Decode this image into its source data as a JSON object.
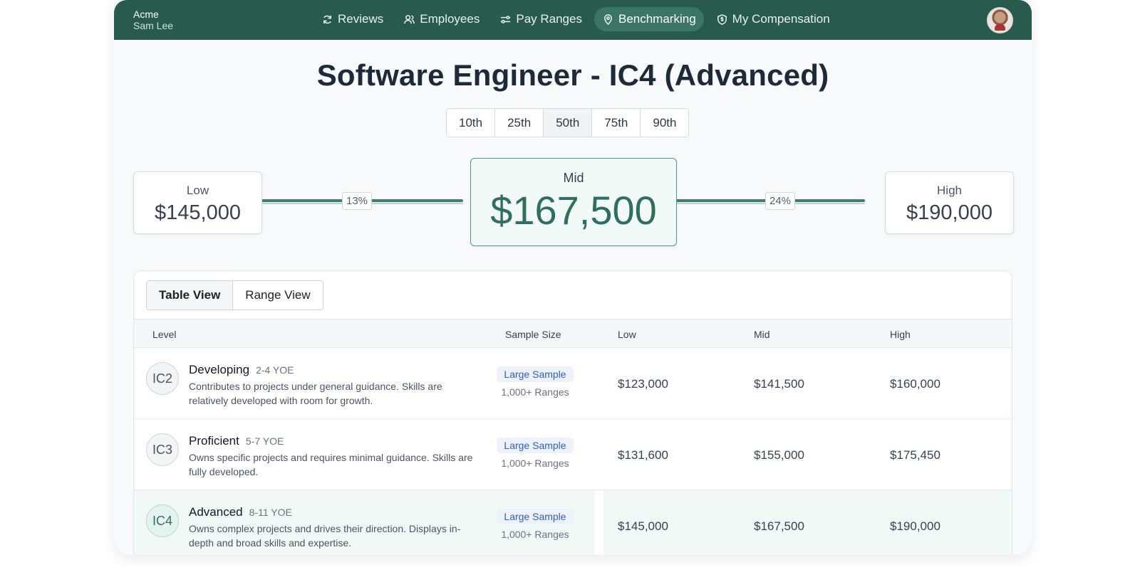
{
  "header": {
    "org": "Acme",
    "user": "Sam Lee",
    "nav": [
      {
        "label": "Reviews",
        "icon": "refresh-icon"
      },
      {
        "label": "Employees",
        "icon": "users-icon"
      },
      {
        "label": "Pay Ranges",
        "icon": "sliders-icon"
      },
      {
        "label": "Benchmarking",
        "icon": "location-pin-icon",
        "active": true
      },
      {
        "label": "My Compensation",
        "icon": "shield-dollar-icon"
      }
    ]
  },
  "title": "Software Engineer - IC4 (Advanced)",
  "percentiles": [
    "10th",
    "25th",
    "50th",
    "75th",
    "90th"
  ],
  "selected_percentile": "50th",
  "range": {
    "low_label": "Low",
    "low_value": "$145,000",
    "mid_label": "Mid",
    "mid_value": "$167,500",
    "high_label": "High",
    "high_value": "$190,000",
    "low_to_mid_pct": "13%",
    "mid_to_high_pct": "24%"
  },
  "views": {
    "table": "Table View",
    "range": "Range View",
    "active": "table"
  },
  "table": {
    "headers": {
      "level": "Level",
      "sample_size": "Sample Size",
      "low": "Low",
      "mid": "Mid",
      "high": "High"
    },
    "rows": [
      {
        "code": "IC2",
        "name": "Developing",
        "yoe": "2-4 YOE",
        "desc": "Contributes to projects under general guidance. Skills are relatively developed with room for growth.",
        "sample": "Large Sample",
        "sample_sub": "1,000+ Ranges",
        "low": "$123,000",
        "mid": "$141,500",
        "high": "$160,000"
      },
      {
        "code": "IC3",
        "name": "Proficient",
        "yoe": "5-7 YOE",
        "desc": "Owns specific projects and requires minimal guidance. Skills are fully developed.",
        "sample": "Large Sample",
        "sample_sub": "1,000+ Ranges",
        "low": "$131,600",
        "mid": "$155,000",
        "high": "$175,450"
      },
      {
        "code": "IC4",
        "name": "Advanced",
        "yoe": "8-11 YOE",
        "desc": "Owns complex projects and drives their direction. Displays in-depth and broad skills and expertise.",
        "sample": "Large Sample",
        "sample_sub": "1,000+ Ranges",
        "low": "$145,000",
        "mid": "$167,500",
        "high": "$190,000",
        "selected": true
      }
    ]
  },
  "colors": {
    "header_bg": "#285b4e",
    "accent": "#2f6f5f",
    "sample_badge": "#2f5fc9"
  }
}
